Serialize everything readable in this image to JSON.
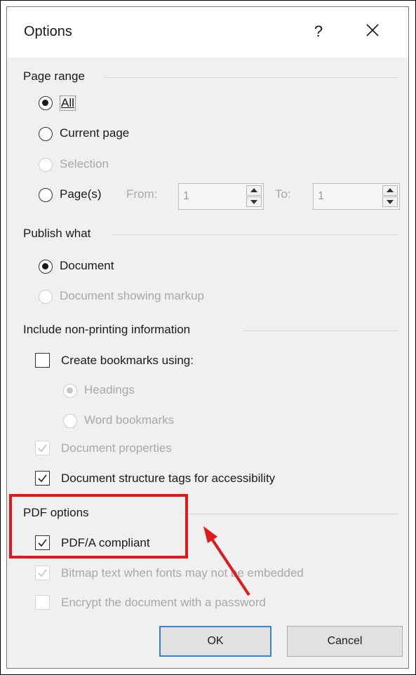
{
  "dialog": {
    "title": "Options",
    "help_label": "?",
    "close_icon": "close-icon"
  },
  "page_range": {
    "section_title": "Page range",
    "all_label": "All",
    "current_page_label": "Current page",
    "selection_label": "Selection",
    "pages_label": "Page(s)",
    "from_label": "From:",
    "from_value": "1",
    "to_label": "To:",
    "to_value": "1",
    "selected": "All"
  },
  "publish_what": {
    "section_title": "Publish what",
    "document_label": "Document",
    "document_markup_label": "Document showing markup",
    "selected": "Document"
  },
  "non_printing": {
    "section_title": "Include non-printing information",
    "create_bookmarks_label": "Create bookmarks using:",
    "create_bookmarks_checked": false,
    "headings_label": "Headings",
    "word_bookmarks_label": "Word bookmarks",
    "doc_properties_label": "Document properties",
    "doc_properties_checked": true,
    "structure_tags_label": "Document structure tags for accessibility",
    "structure_tags_checked": true
  },
  "pdf_options": {
    "section_title": "PDF options",
    "pdfa_label": "PDF/A compliant",
    "pdfa_checked": true,
    "bitmap_label": "Bitmap text when fonts may not be embedded",
    "bitmap_checked": true,
    "encrypt_label": "Encrypt the document with a password",
    "encrypt_checked": false
  },
  "buttons": {
    "ok_label": "OK",
    "cancel_label": "Cancel"
  },
  "annotation": {
    "highlight_color": "#e0191a",
    "arrow_color": "#e0191a"
  }
}
